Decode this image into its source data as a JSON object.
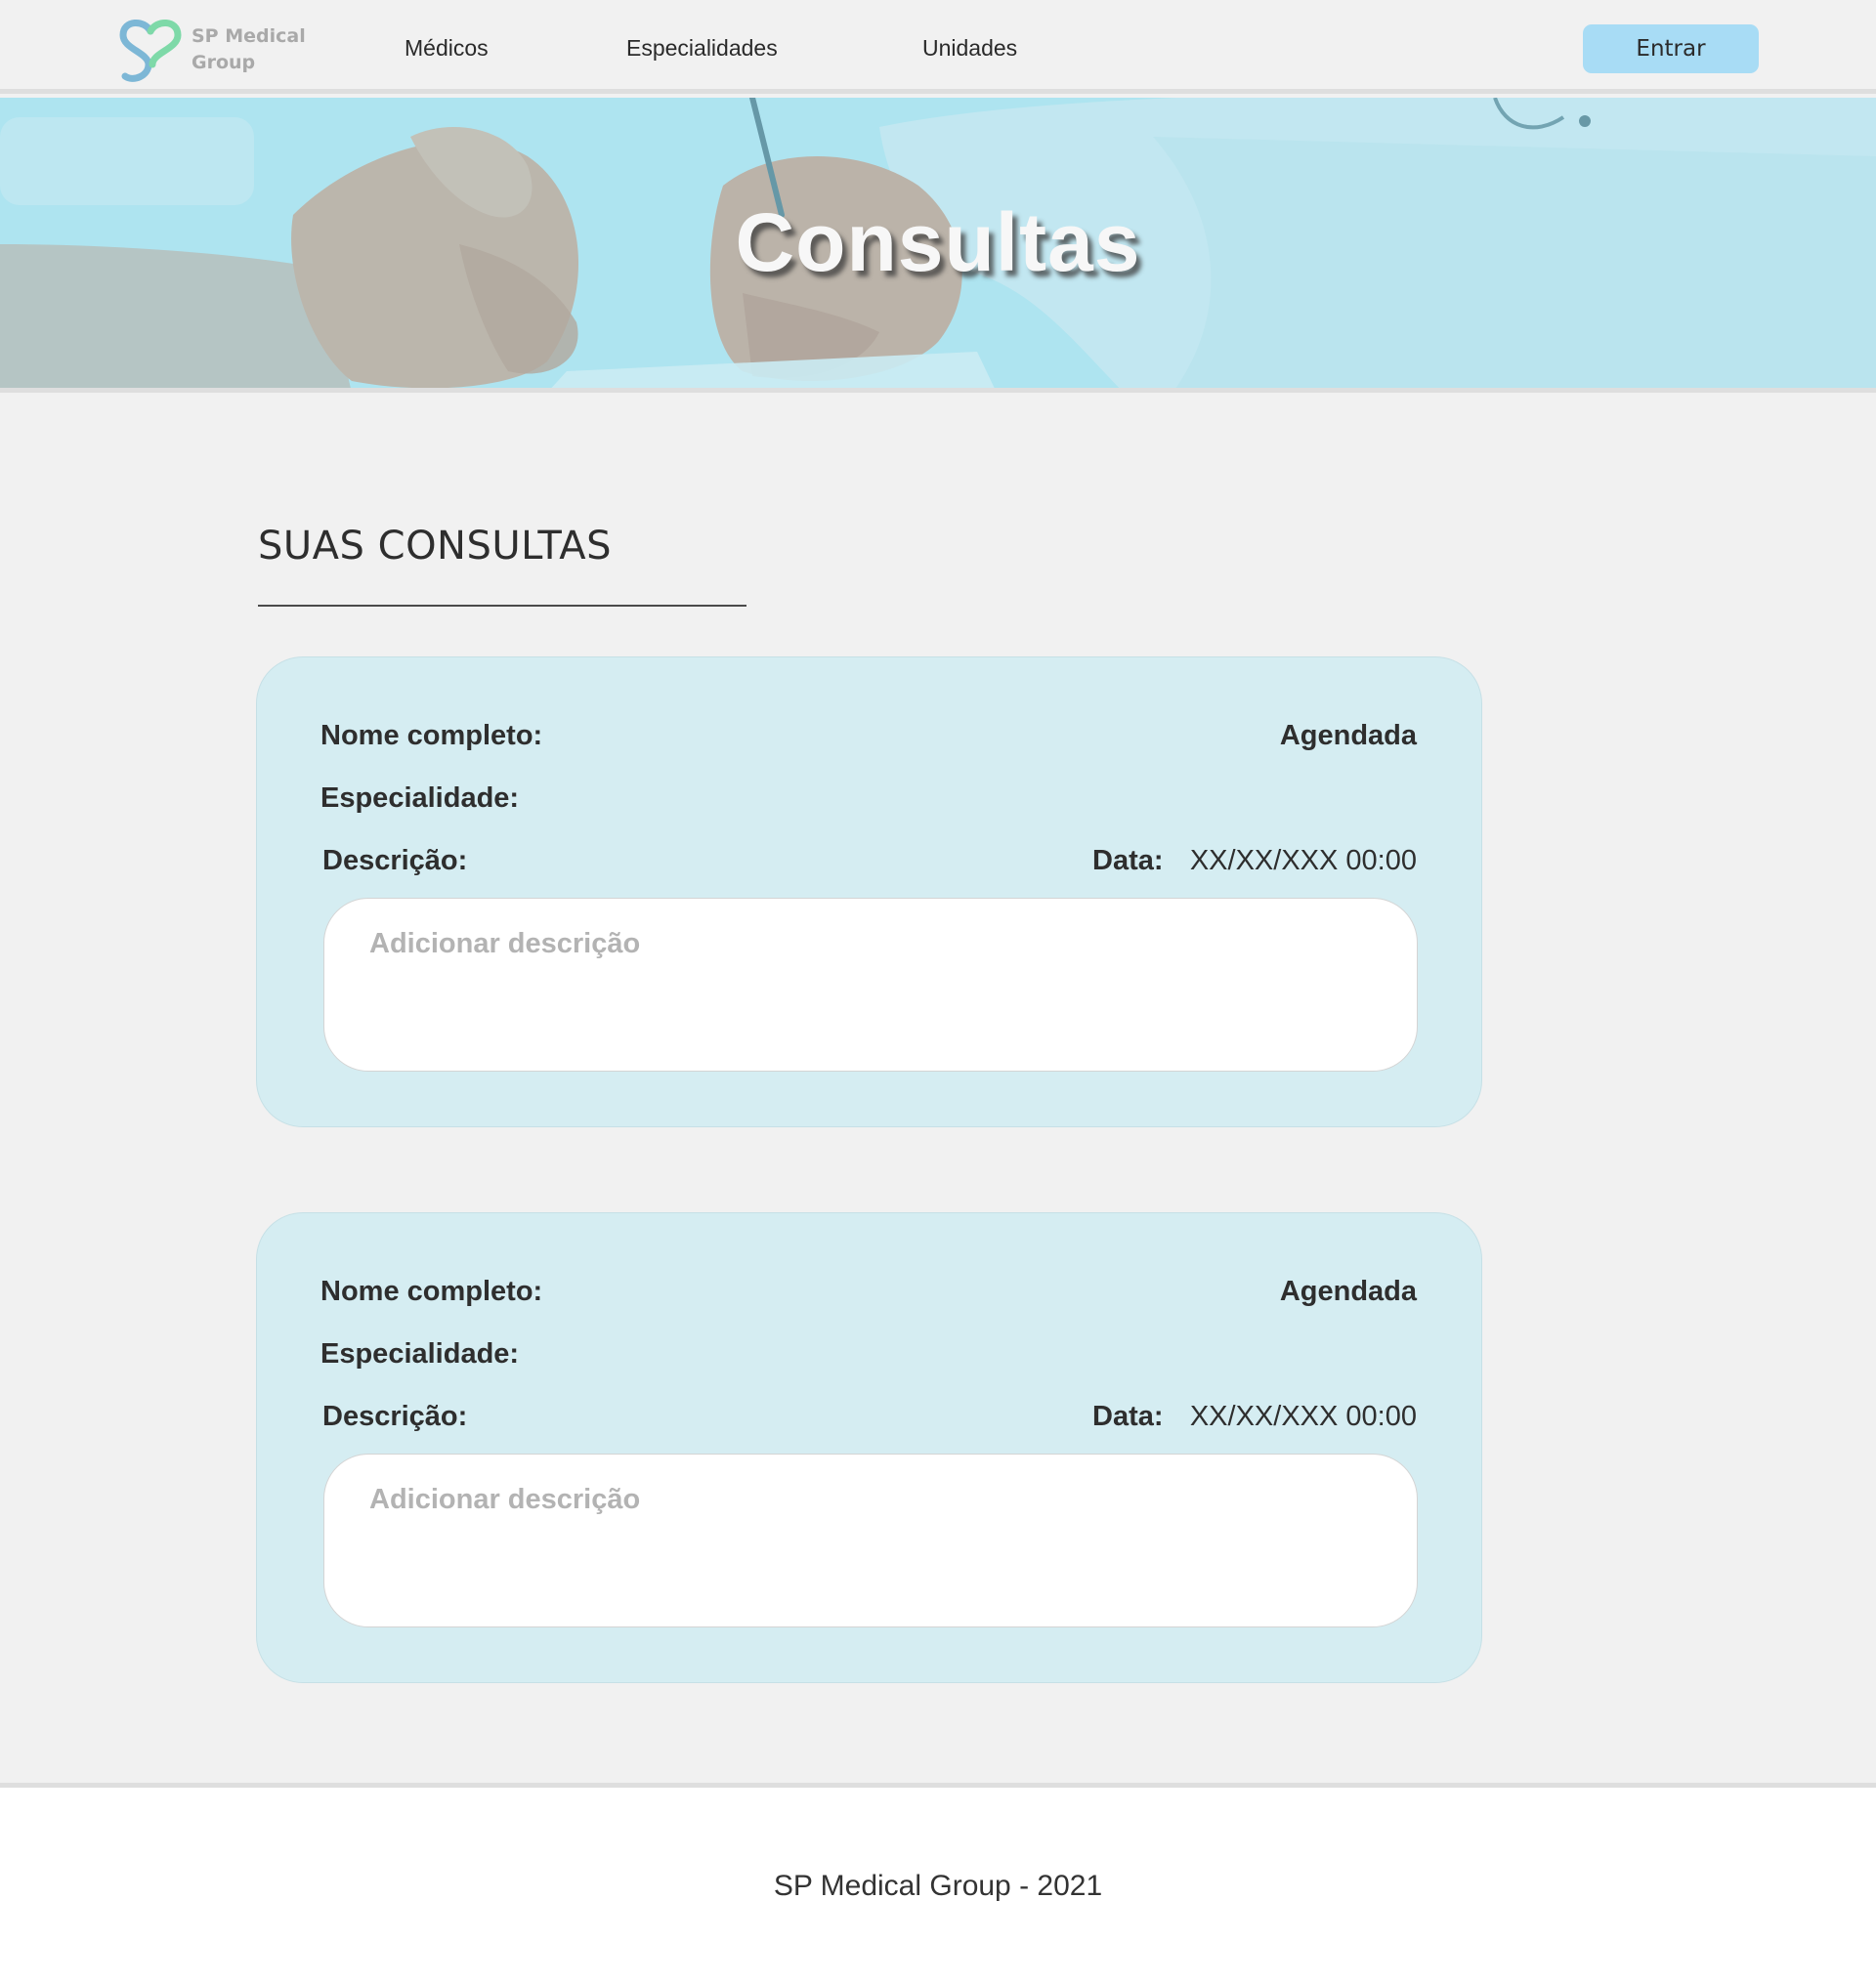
{
  "header": {
    "logo": {
      "line1": "SP Medical",
      "line2": "Group",
      "icon": "heart-s-logo-icon",
      "colors": [
        "#7db7d6",
        "#7ed9a8"
      ]
    },
    "nav": [
      {
        "label": "Médicos"
      },
      {
        "label": "Especialidades"
      },
      {
        "label": "Unidades"
      }
    ],
    "login_label": "Entrar",
    "login_color": "#a8dcf5"
  },
  "hero": {
    "title": "Consultas",
    "image": "doctor-patient-photo"
  },
  "main": {
    "section_title": "SUAS CONSULTAS",
    "cards": [
      {
        "name_label": "Nome completo:",
        "status": "Agendada",
        "specialty_label": "Especialidade:",
        "description_label": "Descrição:",
        "date_label": "Data:",
        "date_value": "XX/XX/XXX 00:00",
        "description_placeholder": "Adicionar descrição"
      },
      {
        "name_label": "Nome completo:",
        "status": "Agendada",
        "specialty_label": "Especialidade:",
        "description_label": "Descrição:",
        "date_label": "Data:",
        "date_value": "XX/XX/XXX 00:00",
        "description_placeholder": "Adicionar descrição"
      }
    ],
    "card_color": "#d5edf2"
  },
  "footer": {
    "text": "SP Medical Group - 2021"
  }
}
